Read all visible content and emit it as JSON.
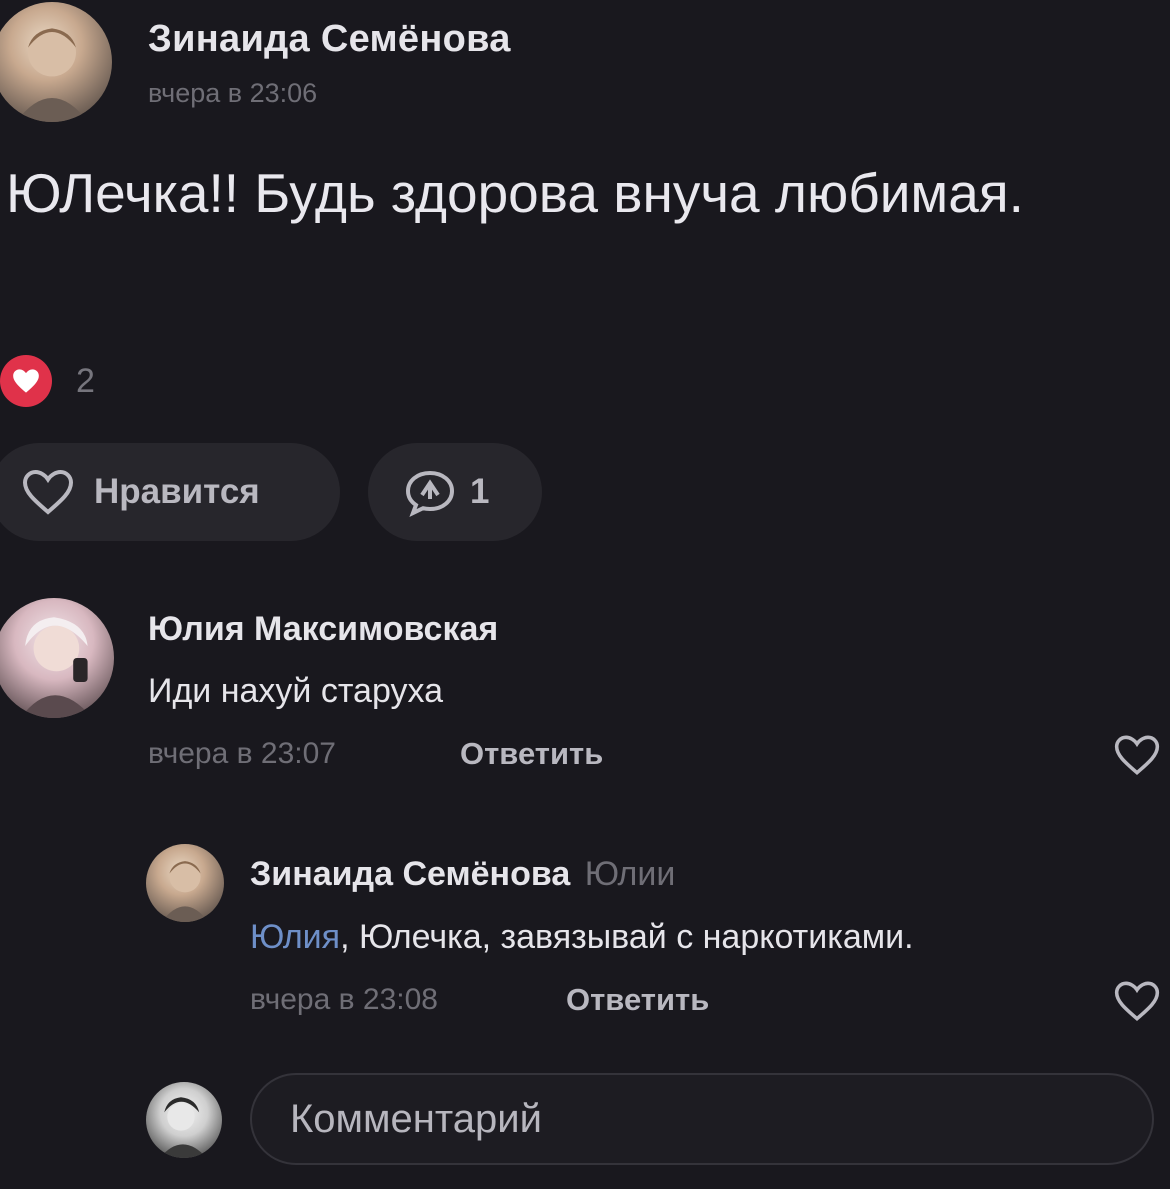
{
  "post": {
    "author": "Зинаида Семёнова",
    "time": "вчера в 23:06",
    "text": "ЮЛечка!! Будь здорова внуча любимая.",
    "reactions_count": "2",
    "like_label": "Нравится",
    "share_count": "1"
  },
  "comments": [
    {
      "author": "Юлия Максимовская",
      "text": "Иди нахуй старуха",
      "time": "вчера в 23:07",
      "reply_label": "Ответить"
    }
  ],
  "reply": {
    "author": "Зинаида Семёнова",
    "addressee": "Юлии",
    "mention": "Юлия",
    "text": ", Юлечка, завязывай с наркотиками.",
    "time": "вчера в 23:08",
    "reply_label": "Ответить"
  },
  "composer": {
    "placeholder": "Комментарий"
  },
  "colors": {
    "background": "#19181e",
    "reaction": "#e0324a",
    "mention": "#6e8fc8"
  }
}
